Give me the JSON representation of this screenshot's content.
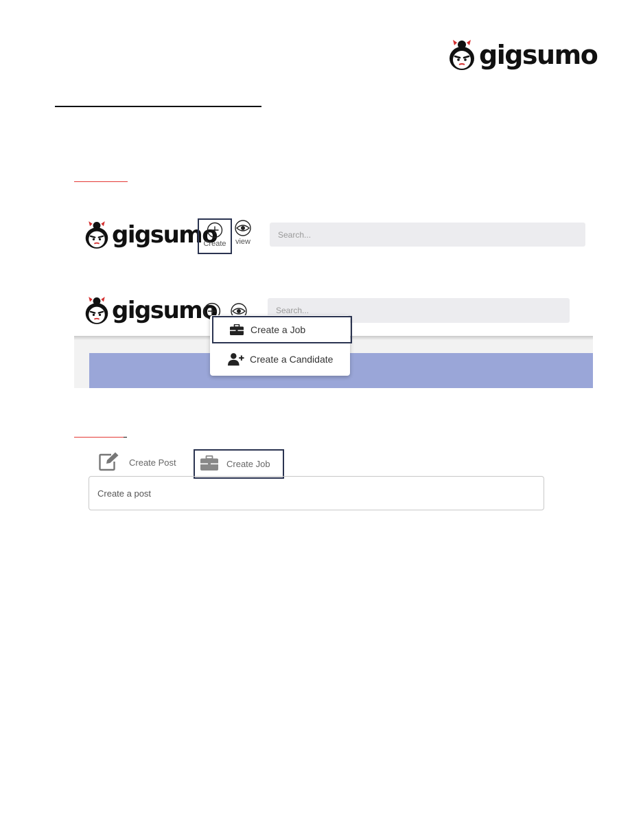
{
  "header": {
    "brand": "gigsumo"
  },
  "nav_example": {
    "brand": "gigsumo",
    "create_label": "Create",
    "view_label": "view",
    "search_placeholder": "Search..."
  },
  "nav_menu_example": {
    "brand": "gigsumo",
    "search_placeholder": "Search...",
    "menu": [
      {
        "label": "Create a Job",
        "icon": "briefcase-icon"
      },
      {
        "label": "Create a Candidate",
        "icon": "add-user-icon"
      }
    ]
  },
  "post_example": {
    "tabs": [
      {
        "label": "Create Post",
        "icon": "edit-icon"
      },
      {
        "label": "Create Job",
        "icon": "briefcase-icon"
      }
    ],
    "post_placeholder": "Create a post"
  },
  "colors": {
    "frame": "#2a3350",
    "accent_red": "#e53935",
    "panel_blue": "#9aa6d8",
    "search_bg": "#ececef"
  }
}
